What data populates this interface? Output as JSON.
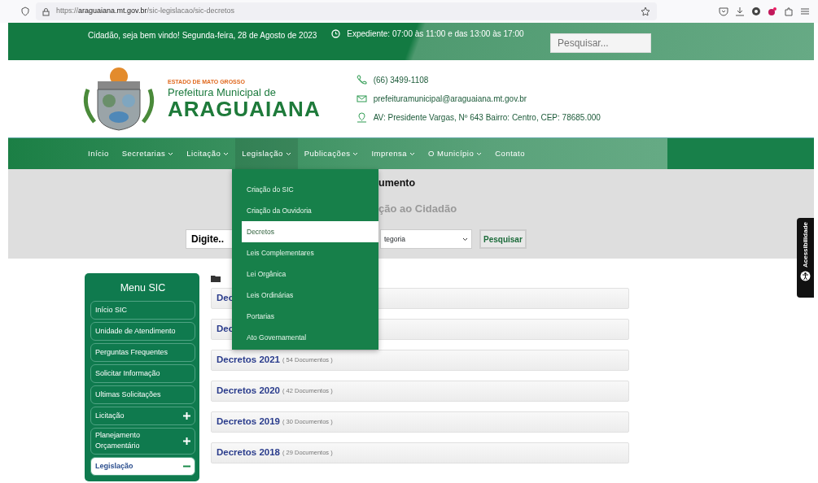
{
  "browser": {
    "url_host": "araguaiana.mt.gov.br",
    "url_prefix": "https://",
    "url_path": "/sic-legislacao/sic-decretos"
  },
  "topbar": {
    "greeting": "Cidadão, seja bem vindo! Segunda-feira, 28 de Agosto de 2023",
    "hours": "Expediente: 07:00 às 11:00 e das 13:00 às 17:00",
    "search_placeholder": "Pesquisar..."
  },
  "header": {
    "state": "ESTADO DE MATO GROSSO",
    "subtitle": "Prefeitura Municipal de",
    "title": "ARAGUAIANA",
    "contacts": [
      {
        "kind": "phone",
        "text": "(66) 3499-1108"
      },
      {
        "kind": "email",
        "text": "prefeituramunicipal@araguaiana.mt.gov.br"
      },
      {
        "kind": "location",
        "text": "AV: Presidente Vargas, Nº 643 Bairro: Centro, CEP: 78685.000"
      }
    ]
  },
  "nav": [
    {
      "label": "Início",
      "has_dropdown": false,
      "open": false
    },
    {
      "label": "Secretarias",
      "has_dropdown": true,
      "open": false
    },
    {
      "label": "Licitação",
      "has_dropdown": true,
      "open": false
    },
    {
      "label": "Legislação",
      "has_dropdown": true,
      "open": true
    },
    {
      "label": "Publicações",
      "has_dropdown": true,
      "open": false
    },
    {
      "label": "Imprensa",
      "has_dropdown": true,
      "open": false
    },
    {
      "label": "O Município",
      "has_dropdown": true,
      "open": false
    },
    {
      "label": "Contato",
      "has_dropdown": false,
      "open": false
    }
  ],
  "dropdown": [
    {
      "label": "Criação do SIC",
      "selected": false
    },
    {
      "label": "Criação da Ouvidoria",
      "selected": false
    },
    {
      "label": "Decretos",
      "selected": true
    },
    {
      "label": "Leis Complementares",
      "selected": false
    },
    {
      "label": "Lei Orgânica",
      "selected": false
    },
    {
      "label": "Leis Ordinárias",
      "selected": false
    },
    {
      "label": "Portarias",
      "selected": false
    },
    {
      "label": "Ato Governamental",
      "selected": false
    }
  ],
  "banner": {
    "title": "umento",
    "subtitle": "ção ao Cidadão",
    "search_value": "Digite..",
    "category": "tegoria",
    "search_button": "Pesquisar"
  },
  "sidebar": {
    "title": "Menu SIC",
    "items": [
      {
        "label": "Início SIC",
        "kind": "link",
        "selected": false
      },
      {
        "label": "Unidade de Atendimento",
        "kind": "link",
        "selected": false
      },
      {
        "label": "Perguntas Frequentes",
        "kind": "link",
        "selected": false
      },
      {
        "label": "Solicitar Informação",
        "kind": "link",
        "selected": false
      },
      {
        "label": "Ultimas Solicitações",
        "kind": "link",
        "selected": false
      },
      {
        "label": "Licitação",
        "kind": "group",
        "expanded": false,
        "selected": false
      },
      {
        "label": "Planejamento Orçamentário",
        "kind": "group",
        "expanded": false,
        "selected": false
      },
      {
        "label": "Legislação",
        "kind": "group",
        "expanded": true,
        "selected": true
      }
    ]
  },
  "folders": [
    {
      "title": "Dec"
    },
    {
      "title": "Dec"
    },
    {
      "title": "Decretos 2021",
      "count": "( 54 Documentos )"
    },
    {
      "title": "Decretos 2020",
      "count": "( 42 Documentos )"
    },
    {
      "title": "Decretos 2019",
      "count": "( 30 Documentos )"
    },
    {
      "title": "Decretos 2018",
      "count": "( 29 Documentos )"
    }
  ],
  "accessibility": {
    "label": "Acessibilidade"
  }
}
